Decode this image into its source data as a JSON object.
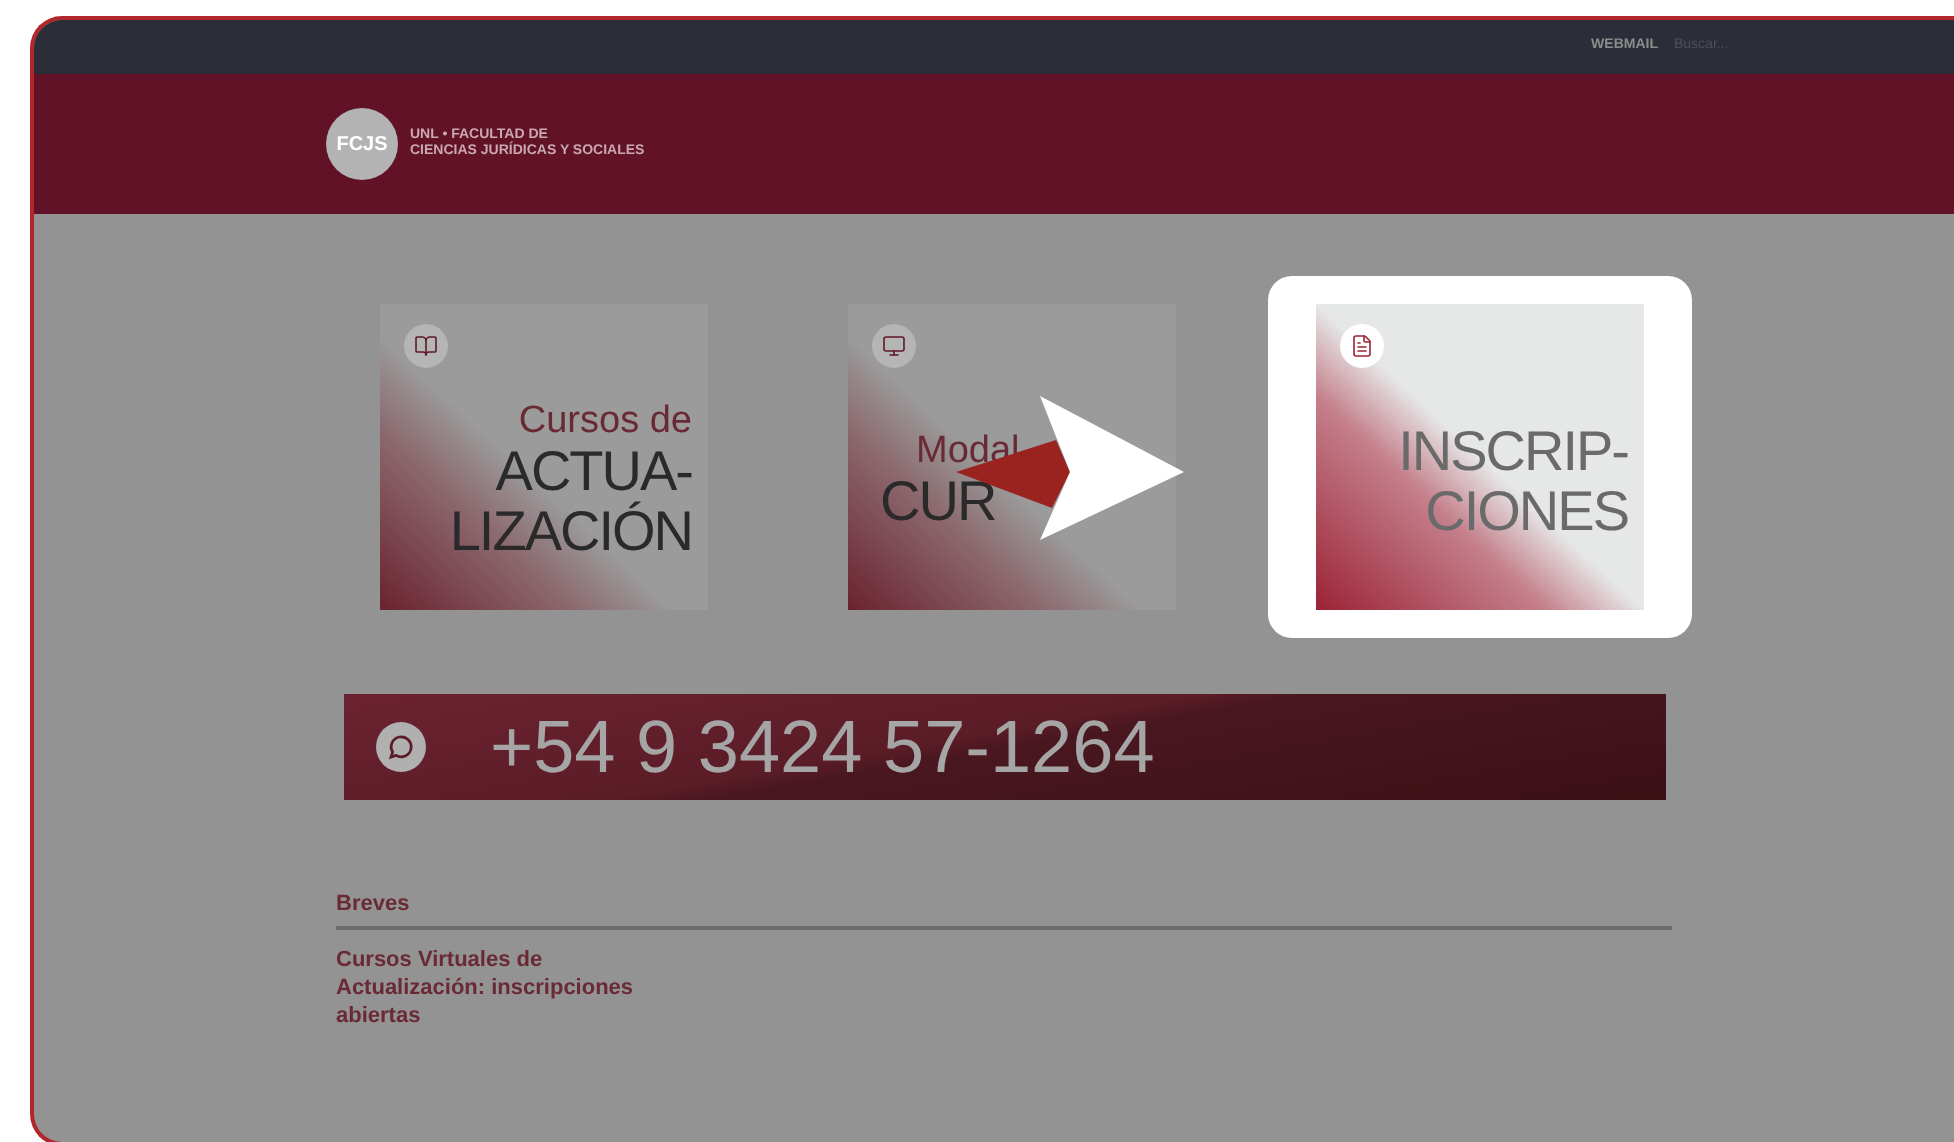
{
  "top_bar": {
    "link": "WEBMAIL",
    "search": {
      "placeholder": "Buscar..."
    }
  },
  "header": {
    "logo": "FCJS",
    "title_lines": [
      "UNL • FACULTAD DE",
      "CIENCIAS JURÍDICAS Y SOCIALES"
    ]
  },
  "tiles": [
    {
      "kind": "book",
      "small_line": "Cursos de",
      "big_lines": [
        "ACTUA-",
        "LIZACIÓN"
      ],
      "selected": false,
      "pointer": false
    },
    {
      "kind": "monitor",
      "small_line": "Modal",
      "big_lines": [
        "CUR"
      ],
      "selected": false,
      "pointer": true
    },
    {
      "kind": "document",
      "big_lines": [
        "INSCRIP-",
        "CIONES"
      ],
      "selected": true,
      "pointer": false
    }
  ],
  "phone_banner": {
    "number": "+54 9 3424 57-1264"
  },
  "news": {
    "heading": "Breves",
    "items": [
      "Cursos Virtuales de Actualización: inscripciones abiertas"
    ]
  }
}
